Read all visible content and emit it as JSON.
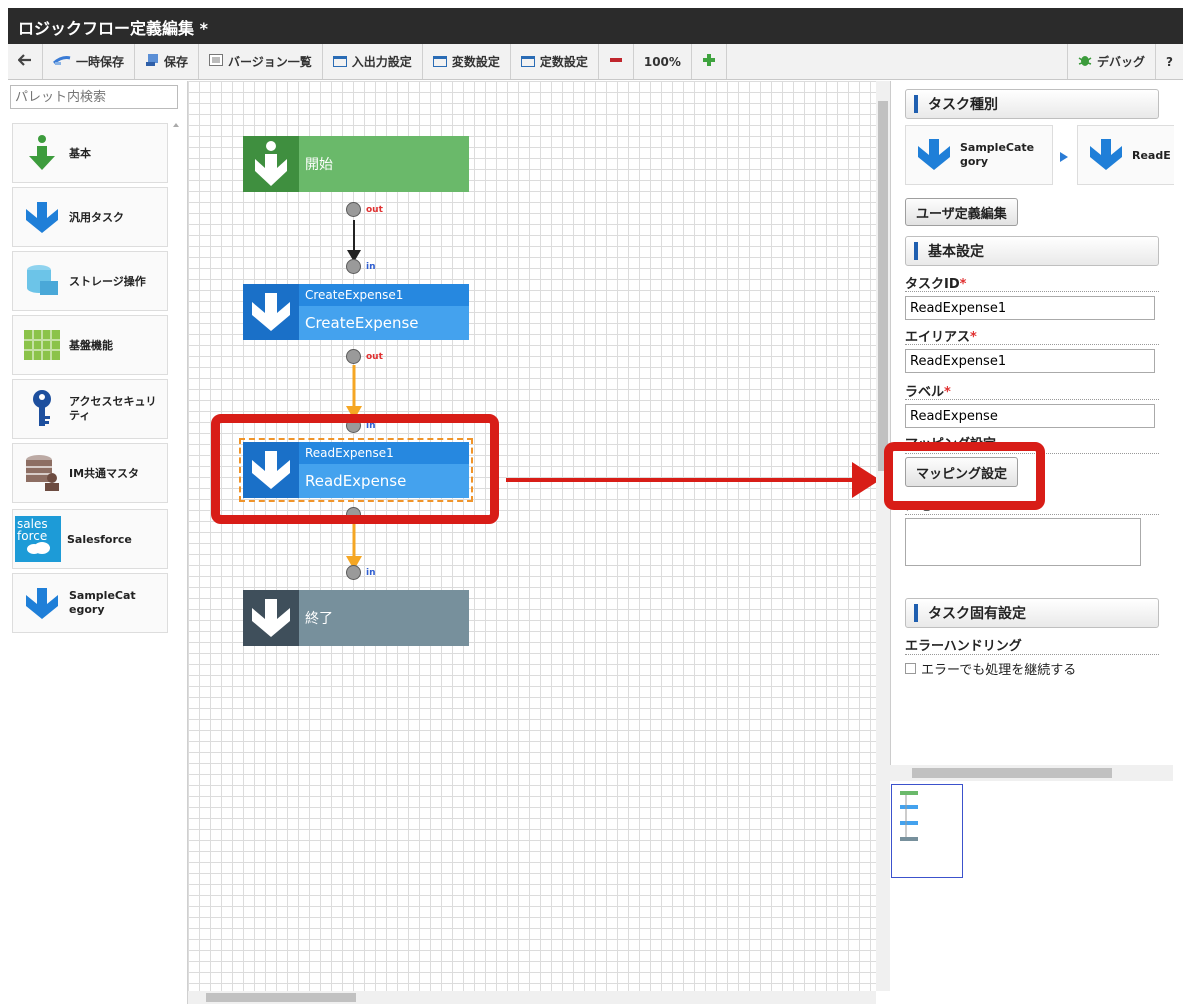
{
  "window": {
    "title": "ロジックフロー定義編集 *"
  },
  "toolbar": {
    "back_icon": "back-arrow-icon",
    "temp_save": "一時保存",
    "save": "保存",
    "versions": "バージョン一覧",
    "io_settings": "入出力設定",
    "var_settings": "変数設定",
    "const_settings": "定数設定",
    "zoom": "100%",
    "debug": "デバッグ",
    "help": "?"
  },
  "palette": {
    "search_placeholder": "パレット内検索",
    "items": [
      {
        "label": "基本",
        "icon": "basic-arrow-icon"
      },
      {
        "label": "汎用タスク",
        "icon": "generic-task-icon"
      },
      {
        "label": "ストレージ操作",
        "icon": "storage-icon"
      },
      {
        "label": "基盤機能",
        "icon": "platform-icon"
      },
      {
        "label": "アクセスセキュリティ",
        "icon": "key-icon"
      },
      {
        "label": "IM共通マスタ",
        "icon": "master-icon"
      },
      {
        "label": "Salesforce",
        "icon": "salesforce-icon",
        "logo_text": [
          "sales",
          "force"
        ]
      },
      {
        "label": "SampleCategory",
        "icon": "sample-category-icon"
      }
    ]
  },
  "flow": {
    "start_label": "開始",
    "end_label": "終了",
    "tasks": [
      {
        "id": "CreateExpense1",
        "name": "CreateExpense"
      },
      {
        "id": "ReadExpense1",
        "name": "ReadExpense"
      }
    ],
    "port_out": "out",
    "port_in": "in"
  },
  "panel": {
    "task_type_header": "タスク種別",
    "task_type_cards": [
      "SampleCategory",
      "ReadE"
    ],
    "user_def_button": "ユーザ定義編集",
    "basic_header": "基本設定",
    "task_id_label": "タスクID",
    "task_id_value": "ReadExpense1",
    "alias_label": "エイリアス",
    "alias_value": "ReadExpense1",
    "label_label": "ラベル",
    "label_value": "ReadExpense",
    "mapping_section_label": "マッピング設定",
    "mapping_button": "マッピング設定",
    "memo_label": "メモ",
    "task_specific_header": "タスク固有設定",
    "error_handling_label": "エラーハンドリング",
    "continue_on_error": "エラーでも処理を継続する",
    "required_mark": "*"
  },
  "colors": {
    "highlight": "#d81d17",
    "start": "#6ab96a",
    "task": "#44a2ee",
    "end": "#77909c",
    "flow_orange": "#f5a623"
  }
}
